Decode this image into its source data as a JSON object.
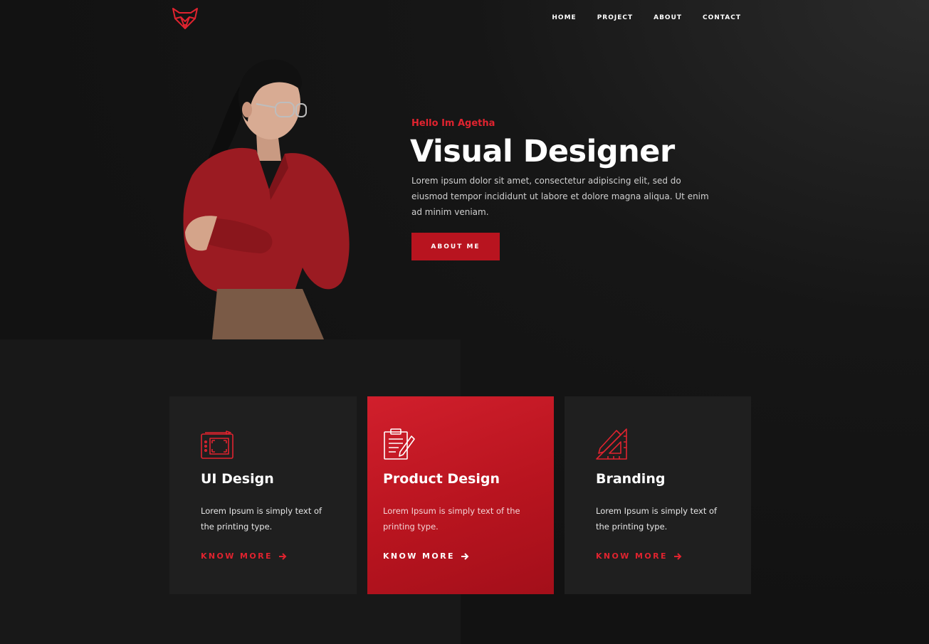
{
  "nav": {
    "logo": "fox-logo-icon",
    "items": [
      {
        "label": "HOME"
      },
      {
        "label": "PROJECT"
      },
      {
        "label": "ABOUT"
      },
      {
        "label": "CONTACT"
      }
    ]
  },
  "hero": {
    "eyebrow": "Hello Im Agetha",
    "title": "Visual Designer",
    "description": "Lorem ipsum dolor sit amet, consectetur adipiscing elit, sed do eiusmod tempor incididunt ut labore et dolore magna aliqua. Ut enim ad minim veniam.",
    "button_label": "ABOUT ME"
  },
  "services": [
    {
      "icon": "drawing-tablet-icon",
      "title": "UI Design",
      "text": "Lorem Ipsum is simply text of the printing type.",
      "link": "KNOW MORE"
    },
    {
      "icon": "clipboard-pencil-icon",
      "title": "Product Design",
      "text": "Lorem Ipsum is simply text of the printing type.",
      "link": "KNOW MORE"
    },
    {
      "icon": "ruler-pencil-icon",
      "title": "Branding",
      "text": "Lorem Ipsum is simply text of the printing type.",
      "link": "KNOW MORE"
    }
  ],
  "colors": {
    "accent": "#e0232f",
    "accent_dark": "#b8141f",
    "background": "#141414",
    "card": "#1f1f1f"
  }
}
